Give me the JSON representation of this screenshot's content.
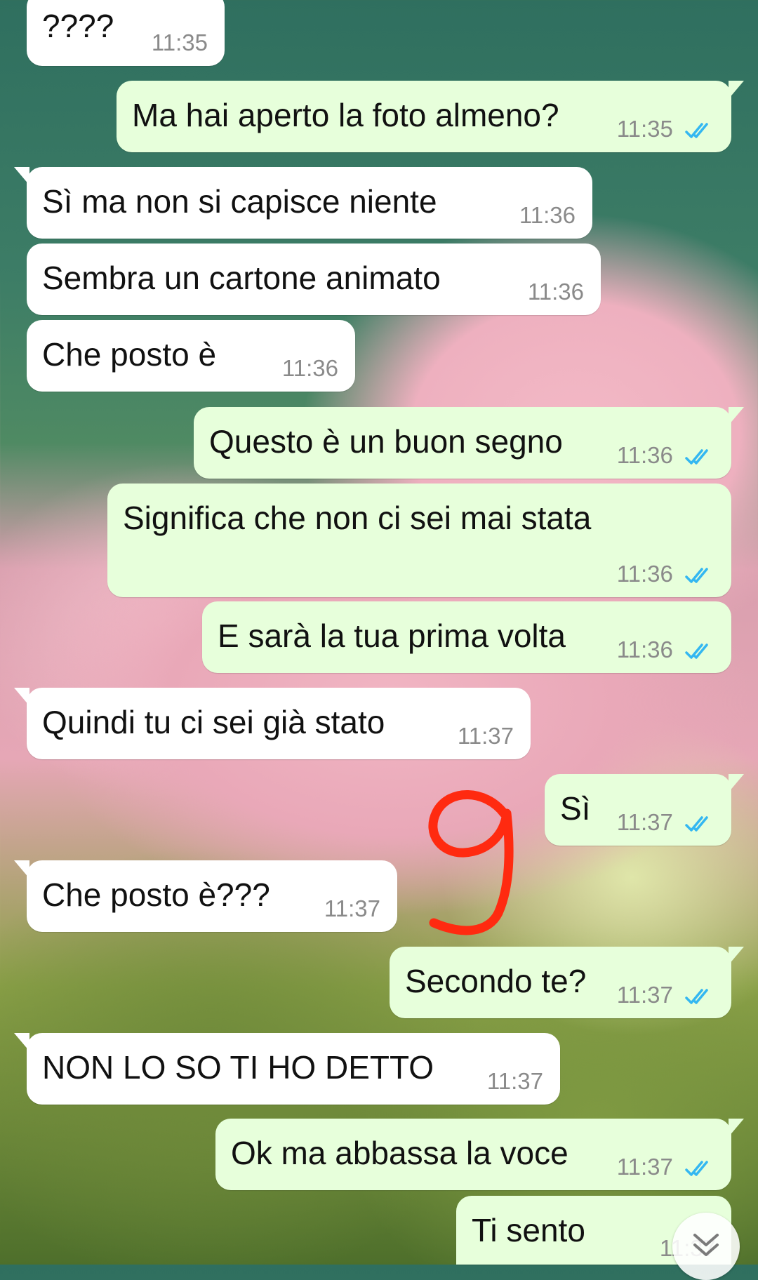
{
  "messages": [
    {
      "dir": "in",
      "text": "????",
      "time": "11:35"
    },
    {
      "dir": "out",
      "text": "Ma hai aperto la foto almeno?",
      "time": "11:35"
    },
    {
      "dir": "in",
      "text": "Sì ma non si capisce niente",
      "time": "11:36"
    },
    {
      "dir": "in",
      "text": "Sembra un cartone animato",
      "time": "11:36"
    },
    {
      "dir": "in",
      "text": "Che posto è",
      "time": "11:36"
    },
    {
      "dir": "out",
      "text": "Questo è un buon segno",
      "time": "11:36"
    },
    {
      "dir": "out",
      "text": "Significa che non ci sei mai stata",
      "time": "11:36"
    },
    {
      "dir": "out",
      "text": "E sarà la tua prima volta",
      "time": "11:36"
    },
    {
      "dir": "in",
      "text": "Quindi tu ci sei già stato",
      "time": "11:37"
    },
    {
      "dir": "out",
      "text": "Sì",
      "time": "11:37"
    },
    {
      "dir": "in",
      "text": "Che posto è???",
      "time": "11:37"
    },
    {
      "dir": "out",
      "text": "Secondo te?",
      "time": "11:37"
    },
    {
      "dir": "in",
      "text": "NON LO SO TI HO DETTO",
      "time": "11:37"
    },
    {
      "dir": "out",
      "text": "Ok ma abbassa la voce",
      "time": "11:37"
    },
    {
      "dir": "out",
      "text": "Ti sento",
      "time": "11:37"
    }
  ],
  "colors": {
    "incoming_bubble": "#ffffff",
    "outgoing_bubble": "#e7ffdb",
    "read_ticks": "#34b7f1",
    "annotation": "#ff2a10"
  },
  "icons": {
    "read_receipt": "double-check-icon",
    "scroll_down": "double-chevron-down-icon"
  },
  "annotation": {
    "drawn_symbol": "9"
  }
}
